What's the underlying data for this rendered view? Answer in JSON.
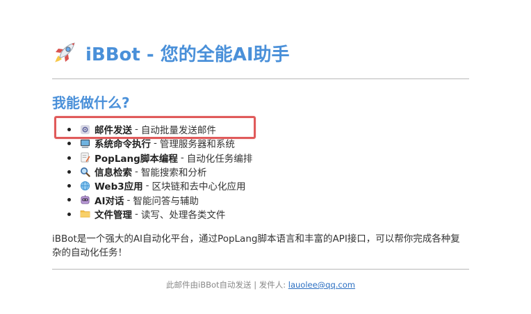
{
  "header": {
    "title": "iBBot - 您的全能AI助手",
    "title_icon": "rocket-icon",
    "accent_color": "#4a90d9"
  },
  "section": {
    "heading": "我能做什么?"
  },
  "features": [
    {
      "icon": "gear-icon",
      "name": "邮件发送",
      "desc": "自动批量发送邮件",
      "highlighted": true
    },
    {
      "icon": "terminal-icon",
      "name": "系统命令执行",
      "desc": "管理服务器和系统",
      "highlighted": false
    },
    {
      "icon": "script-icon",
      "name": "PopLang脚本编程",
      "desc": "自动化任务编排",
      "highlighted": false
    },
    {
      "icon": "magnifier-icon",
      "name": "信息检索",
      "desc": "智能搜索和分析",
      "highlighted": false
    },
    {
      "icon": "globe-icon",
      "name": "Web3应用",
      "desc": "区块链和去中心化应用",
      "highlighted": false
    },
    {
      "icon": "robot-icon",
      "name": "AI对话",
      "desc": "智能问答与辅助",
      "highlighted": false
    },
    {
      "icon": "folder-icon",
      "name": "文件管理",
      "desc": "读写、处理各类文件",
      "highlighted": false
    }
  ],
  "feature_separator": "-",
  "description": "iBBot是一个强大的AI自动化平台，通过PopLang脚本语言和丰富的API接口，可以帮你完成各种复杂的自动化任务！",
  "footer": {
    "prefix": "此邮件由iBBot自动发送 | 发件人: ",
    "sender_email": "lauolee@qq.com"
  },
  "highlight_color": "#e05a5a"
}
